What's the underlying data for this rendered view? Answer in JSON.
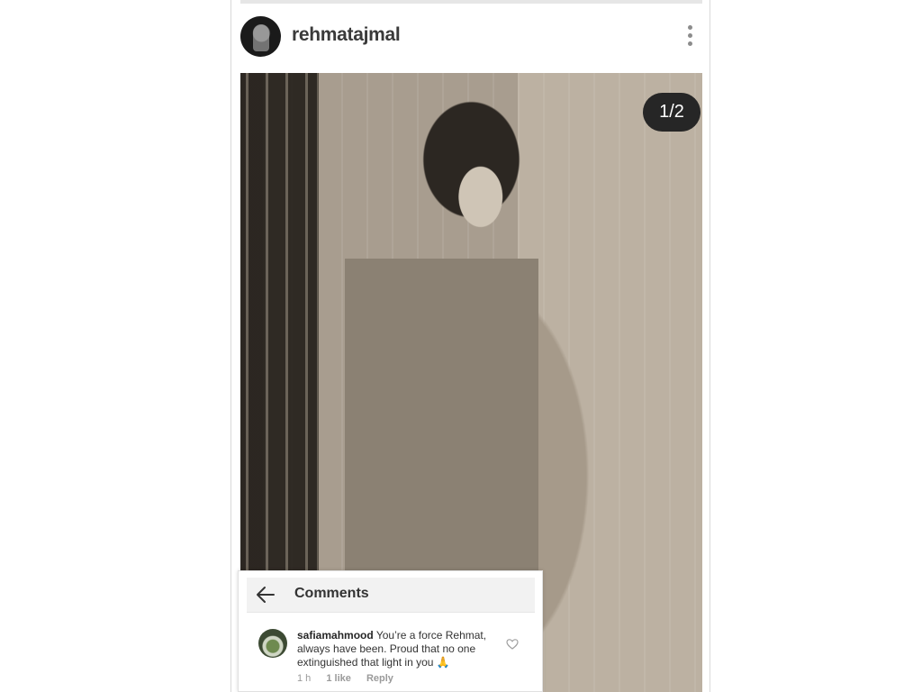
{
  "post": {
    "username": "rehmatajmal",
    "photo_counter": "1/2"
  },
  "comments": {
    "title": "Comments",
    "items": [
      {
        "user": "safiamahmood",
        "text": "You’re a force Rehmat, always have been. Proud that no one extinguished that light in you",
        "emoji": "🙏",
        "time": "1 h",
        "likes": "1 like",
        "reply_label": "Reply"
      }
    ]
  }
}
